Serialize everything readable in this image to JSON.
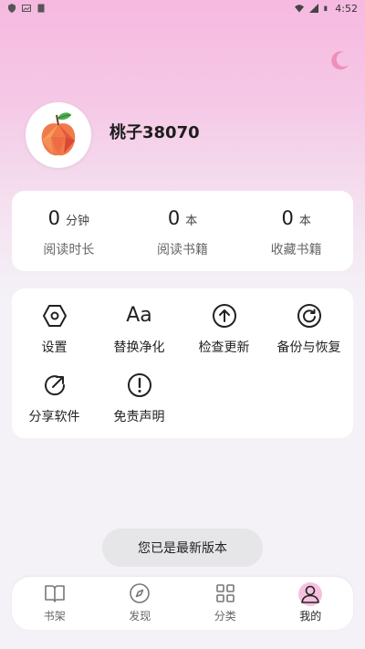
{
  "status_bar": {
    "time": "4:52"
  },
  "profile": {
    "username": "桃子38070"
  },
  "stats": [
    {
      "value": "0",
      "unit": "分钟",
      "label": "阅读时长"
    },
    {
      "value": "0",
      "unit": "本",
      "label": "阅读书籍"
    },
    {
      "value": "0",
      "unit": "本",
      "label": "收藏书籍"
    }
  ],
  "tools": [
    {
      "label": "设置",
      "icon": "hexagon-settings-icon"
    },
    {
      "label": "替换净化",
      "icon": "font-aa-icon",
      "glyph": "Aa"
    },
    {
      "label": "检查更新",
      "icon": "arrow-up-circle-icon"
    },
    {
      "label": "备份与恢复",
      "icon": "restore-circle-icon"
    },
    {
      "label": "分享软件",
      "icon": "share-icon"
    },
    {
      "label": "免责声明",
      "icon": "exclamation-circle-icon"
    }
  ],
  "toast": {
    "text": "您已是最新版本"
  },
  "bottom_nav": [
    {
      "label": "书架",
      "icon": "book-icon",
      "active": false
    },
    {
      "label": "发现",
      "icon": "compass-icon",
      "active": false
    },
    {
      "label": "分类",
      "icon": "grid-icon",
      "active": false
    },
    {
      "label": "我的",
      "icon": "person-icon",
      "active": true
    }
  ],
  "colors": {
    "accent_pink": "#f6b9e0",
    "moon": "#f08fb8",
    "active_bg": "#f6c1df"
  }
}
